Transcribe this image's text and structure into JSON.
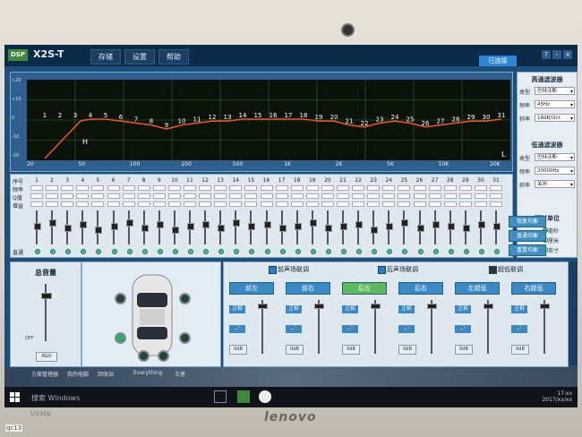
{
  "app": {
    "title": "X2S-T",
    "logo_text": "DSP",
    "menu": [
      "存储",
      "设置",
      "帮助"
    ],
    "status": "已连接",
    "window_controls": [
      "?",
      "-",
      "×"
    ]
  },
  "graph": {
    "band_labels": [
      "1",
      "2",
      "3",
      "4",
      "5",
      "6",
      "7",
      "8",
      "9",
      "10",
      "11",
      "12",
      "13",
      "14",
      "15",
      "16",
      "17",
      "18",
      "19",
      "20",
      "21",
      "22",
      "23",
      "24",
      "25",
      "26",
      "27",
      "28",
      "29",
      "30",
      "31"
    ],
    "freq_axis": [
      "20",
      "50",
      "100",
      "200",
      "500",
      "1K",
      "2K",
      "5K",
      "10K",
      "20K"
    ],
    "y_ticks": [
      "+20",
      "+10",
      "0",
      "-10",
      "-20"
    ],
    "h_marker": "H",
    "l_marker": "L",
    "curve_color": "#e8552a",
    "grid_color": "#2e6b2e"
  },
  "eq_grid": {
    "row_labels": [
      "序号",
      "频率",
      "Q值",
      "增益"
    ],
    "columns": [
      "1",
      "2",
      "3",
      "4",
      "5",
      "6",
      "7",
      "8",
      "9",
      "10",
      "11",
      "12",
      "13",
      "14",
      "15",
      "16",
      "17",
      "18",
      "19",
      "20",
      "21",
      "22",
      "23",
      "24",
      "25",
      "26",
      "27",
      "28",
      "29",
      "30",
      "31"
    ],
    "direct_label": "直通",
    "buttons": [
      "恢复均衡",
      "直通均衡",
      "重置均衡"
    ]
  },
  "filters": {
    "highpass_title": "高通滤波器",
    "lowpass_title": "低通滤波器",
    "labels": {
      "type": "类型",
      "freq": "频率",
      "slope": "斜率"
    },
    "hp": {
      "type": "巴特沃斯",
      "freq": "45Hz",
      "slope": "18dB/Oct"
    },
    "lp": {
      "type": "巴特沃斯",
      "freq": "20000Hz",
      "slope": "关闭"
    }
  },
  "delay": {
    "title": "延时单位",
    "options": [
      "毫秒",
      "厘米",
      "英寸"
    ]
  },
  "master": {
    "title": "总音量",
    "button": "AGO",
    "off_label": "OFF"
  },
  "channels": {
    "checks": [
      "前声场联调",
      "后声场联调",
      "超低联调"
    ],
    "names": [
      "前左",
      "前右",
      "后左",
      "后右",
      "左超低",
      "右超低"
    ],
    "active_index": 2,
    "sub_buttons": {
      "phase": "正相",
      "db": "0dB",
      "mute": "🔊"
    }
  },
  "taskbar": {
    "desktop_items": [
      "方案管理器",
      "我的电脑",
      "回收站",
      "Everything",
      "王者"
    ],
    "search_placeholder": "搜索 Windows",
    "time": "17:xx",
    "date": "2017/xx/xx"
  },
  "laptop": {
    "model": "U330p",
    "brand": "lenovo",
    "watermark": "qc13"
  },
  "colors": {
    "accent": "#2a86d8",
    "active_green": "#5cb85c"
  }
}
